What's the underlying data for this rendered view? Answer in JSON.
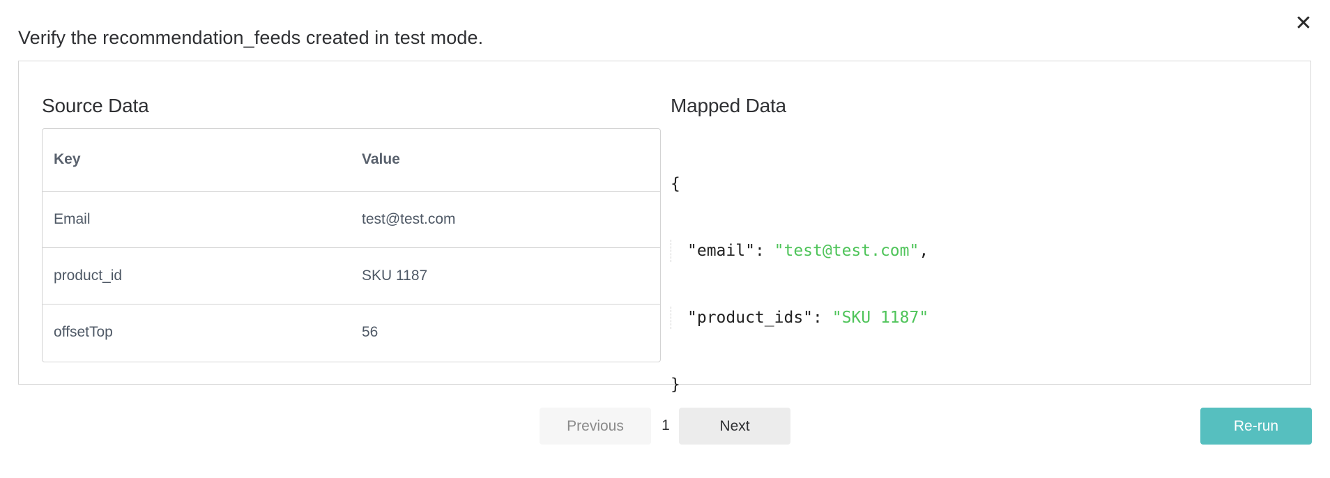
{
  "modal": {
    "title": "Verify the recommendation_feeds created in test mode.",
    "close_icon": "close-icon",
    "close_glyph": "✕"
  },
  "source": {
    "title": "Source Data",
    "columns": [
      "Key",
      "Value"
    ],
    "rows": [
      {
        "key": "Email",
        "value": "test@test.com"
      },
      {
        "key": "product_id",
        "value": "SKU 1187"
      },
      {
        "key": "offsetTop",
        "value": "56"
      }
    ]
  },
  "mapped": {
    "title": "Mapped Data",
    "open_brace": "{",
    "close_brace": "}",
    "entries": [
      {
        "key": "\"email\"",
        "sep": ": ",
        "value": "\"test@test.com\"",
        "trail": ","
      },
      {
        "key": "\"product_ids\"",
        "sep": ": ",
        "value": "\"SKU 1187\"",
        "trail": ""
      }
    ],
    "string_color": "#4fc45a"
  },
  "pagination": {
    "previous_label": "Previous",
    "page": "1",
    "next_label": "Next"
  },
  "actions": {
    "rerun_label": "Re-run",
    "rerun_color": "#56bfbf"
  }
}
